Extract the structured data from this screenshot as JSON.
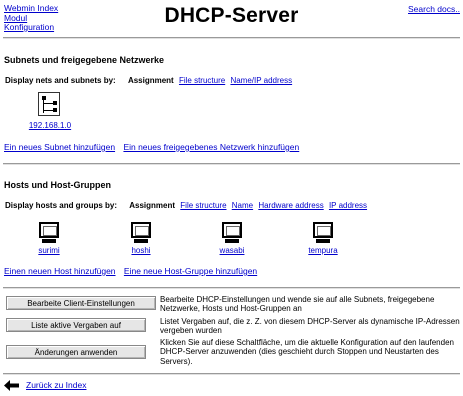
{
  "header": {
    "links": [
      "Webmin Index",
      "Modul",
      "Konfiguration"
    ],
    "title": "DHCP-Server",
    "search_link": "Search docs.."
  },
  "subnets": {
    "heading": "Subnets und freigegebene Netzwerke",
    "display_label": "Display nets and subnets by:",
    "selected_mode": "Assignment",
    "modes": [
      "File structure",
      "Name/IP address"
    ],
    "items": [
      {
        "label": "192.168.1.0",
        "icon": "network-icon"
      }
    ],
    "actions": [
      "Ein neues Subnet hinzufügen",
      "Ein neues freigegebenes Netzwerk hinzufügen"
    ]
  },
  "hosts": {
    "heading": "Hosts und Host-Gruppen",
    "display_label": "Display hosts and groups by:",
    "selected_mode": "Assignment",
    "modes": [
      "File structure",
      "Name",
      "Hardware address",
      "IP address"
    ],
    "items": [
      {
        "label": "surimi",
        "icon": "host-icon"
      },
      {
        "label": "hoshi",
        "icon": "host-icon"
      },
      {
        "label": "wasabi",
        "icon": "host-icon"
      },
      {
        "label": "tempura",
        "icon": "host-icon"
      }
    ],
    "actions": [
      "Einen neuen Host hinzufügen",
      "Eine neue Host-Gruppe hinzufügen"
    ]
  },
  "buttons": [
    {
      "label": "Bearbeite Client-Einstellungen",
      "description": "Bearbeite DHCP-Einstellungen und wende sie auf alle Subnets, freigegebene Netzwerke, Hosts und Host-Gruppen an"
    },
    {
      "label": "Liste aktive Vergaben auf",
      "description": "Listet Vergaben auf, die z. Z. von diesem DHCP-Server als dynamische IP-Adressen vergeben wurden"
    },
    {
      "label": "Änderungen anwenden",
      "description": "Klicken Sie auf diese Schaltfläche, um die aktuelle Konfiguration auf den laufenden DHCP-Server anzuwenden (dies geschieht durch Stoppen und Neustarten des Servers)."
    }
  ],
  "footer": {
    "back_link": "Zurück zu Index"
  }
}
